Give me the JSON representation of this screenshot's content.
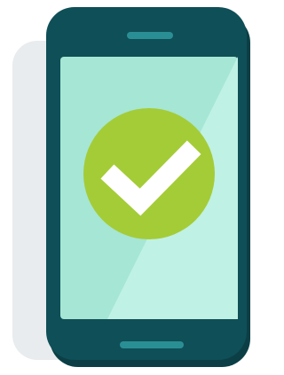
{
  "illustration": {
    "subject": "smartphone-with-checkmark",
    "icons": {
      "device": "smartphone-icon",
      "status": "check-circle-icon"
    },
    "colors": {
      "background": "#ffffff",
      "shadow": "#e8ecef",
      "phone_body": "#0f4f57",
      "phone_body_dark": "#0b3f45",
      "speaker": "#2a8f95",
      "home_bar": "#2a8f95",
      "screen": "#a6e6d5",
      "screen_highlight": "#c0f1e5",
      "check_circle": "#a4cc36",
      "check_mark": "#ffffff"
    }
  }
}
